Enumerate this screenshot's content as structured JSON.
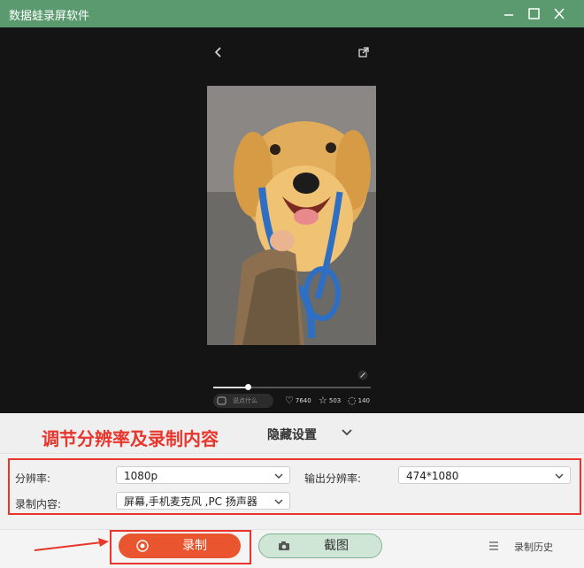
{
  "window": {
    "title": "数据蛙录屏软件"
  },
  "viewer": {
    "comment_placeholder": "说点什么",
    "likes": "7640",
    "favorites": "503",
    "comments": "140",
    "progress": 0.22
  },
  "annotation": "调节分辨率及录制内容",
  "settings_toggle": {
    "label": "隐藏设置"
  },
  "settings": {
    "resolution_label": "分辨率:",
    "resolution_value": "1080p",
    "output_label": "输出分辨率:",
    "output_value": "474*1080",
    "content_label": "录制内容:",
    "content_value": "屏幕,手机麦克风 ,PC 扬声器"
  },
  "actions": {
    "record_label": "录制",
    "screenshot_label": "截图",
    "history_label": "录制历史"
  },
  "colors": {
    "titlebar": "#5a9a6e",
    "record": "#e8552e",
    "annotation": "#e8362c"
  }
}
